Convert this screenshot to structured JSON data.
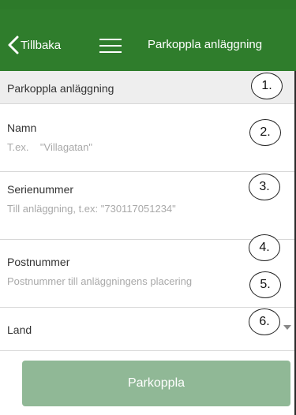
{
  "navbar": {
    "back_label": "Tillbaka",
    "title": "Parkoppla anläggning"
  },
  "section": {
    "header": "Parkoppla anläggning"
  },
  "form": {
    "name": {
      "label": "Namn",
      "placeholder": "T.ex.    \"Villagatan\""
    },
    "serial": {
      "label": "Serienummer",
      "placeholder": "Till anläggning, t.ex: \"730117051234\""
    },
    "postal": {
      "label": "Postnummer",
      "placeholder": "Postnummer till anläggningens placering"
    },
    "country": {
      "label": "Land"
    }
  },
  "submit": {
    "label": "Parkoppla"
  },
  "callouts": [
    "1.",
    "2.",
    "3.",
    "4.",
    "5.",
    "6."
  ],
  "colors": {
    "navbar": "#2f7d2c",
    "button": "#90b896",
    "section_bg": "#eeeeee"
  },
  "icons": {
    "back": "chevron-left-icon",
    "menu": "hamburger-menu-icon",
    "dropdown": "caret-down-icon"
  }
}
